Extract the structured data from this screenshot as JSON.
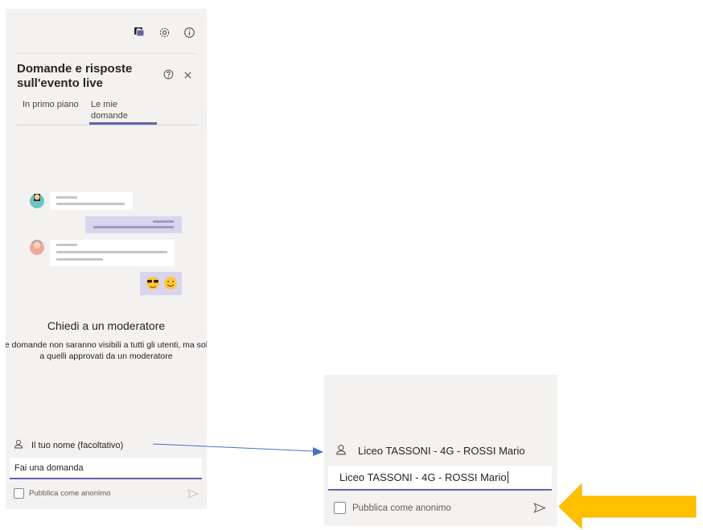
{
  "panel": {
    "title": "Domande e risposte sull'evento live",
    "tabs": [
      {
        "label": "In primo piano",
        "active": false
      },
      {
        "label": "Le mie domande",
        "active": true
      }
    ],
    "empty_state": {
      "title": "Chiedi a un moderatore",
      "description": "Le domande non saranno visibili a tutti gli utenti, ma solo a quelli approvati da un moderatore"
    },
    "name_placeholder": "Il tuo nome (facoltativo)",
    "question_placeholder": "Fai una domanda",
    "anonymous_label": "Pubblica come anonimo"
  },
  "zoom": {
    "name_value": "Liceo TASSONI - 4G - ROSSI Mario",
    "question_value": "Liceo TASSONI - 4G - ROSSI Mario",
    "anonymous_label": "Pubblica come anonimo"
  },
  "icons": {
    "top": [
      "qna-icon",
      "gear-icon",
      "info-icon"
    ],
    "title": [
      "help-icon",
      "close-icon"
    ]
  },
  "colors": {
    "accent": "#6264a7",
    "panel_bg": "#f3f2f1",
    "connector": "#4472c4",
    "callout_arrow": "#ffc000"
  }
}
